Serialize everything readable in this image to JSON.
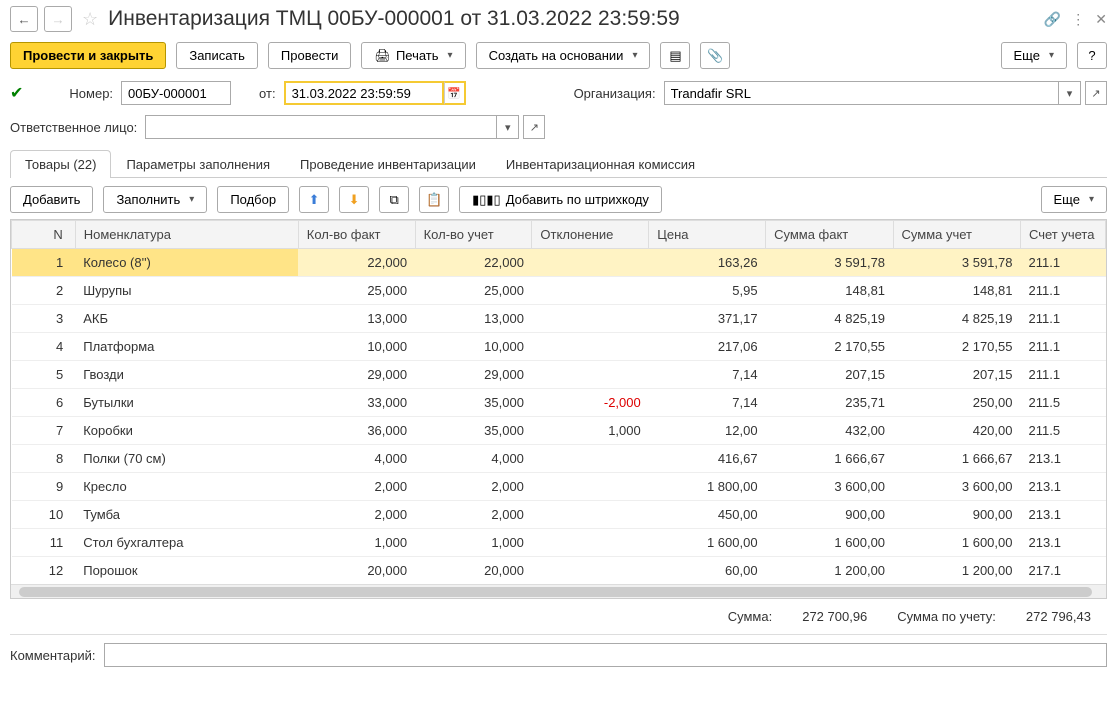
{
  "header": {
    "title": "Инвентаризация ТМЦ 00БУ-000001 от 31.03.2022 23:59:59"
  },
  "toolbar": {
    "post_close": "Провести и закрыть",
    "write": "Записать",
    "post": "Провести",
    "print": "Печать",
    "create_based": "Создать на основании",
    "more": "Еще",
    "help": "?"
  },
  "form": {
    "number_label": "Номер:",
    "number_value": "00БУ-000001",
    "from_label": "от:",
    "date_value": "31.03.2022 23:59:59",
    "org_label": "Организация:",
    "org_value": "Trandafir SRL",
    "resp_label": "Ответственное лицо:",
    "resp_value": ""
  },
  "tabs": {
    "goods": "Товары (22)",
    "fill_params": "Параметры заполнения",
    "inventory": "Проведение инвентаризации",
    "commission": "Инвентаризационная комиссия"
  },
  "table_toolbar": {
    "add": "Добавить",
    "fill": "Заполнить",
    "pick": "Подбор",
    "add_barcode": "Добавить по штрихкоду",
    "more": "Еще"
  },
  "columns": {
    "n": "N",
    "nomen": "Номенклатура",
    "qty_fact": "Кол-во факт",
    "qty_acc": "Кол-во учет",
    "deviation": "Отклонение",
    "price": "Цена",
    "sum_fact": "Сумма факт",
    "sum_acc": "Сумма учет",
    "account": "Счет учета"
  },
  "rows": [
    {
      "n": "1",
      "nomen": "Колесо (8'')",
      "qf": "22,000",
      "qa": "22,000",
      "dev": "",
      "price": "163,26",
      "sf": "3 591,78",
      "sa": "3 591,78",
      "acct": "211.1"
    },
    {
      "n": "2",
      "nomen": "Шурупы",
      "qf": "25,000",
      "qa": "25,000",
      "dev": "",
      "price": "5,95",
      "sf": "148,81",
      "sa": "148,81",
      "acct": "211.1"
    },
    {
      "n": "3",
      "nomen": "АКБ",
      "qf": "13,000",
      "qa": "13,000",
      "dev": "",
      "price": "371,17",
      "sf": "4 825,19",
      "sa": "4 825,19",
      "acct": "211.1"
    },
    {
      "n": "4",
      "nomen": "Платформа",
      "qf": "10,000",
      "qa": "10,000",
      "dev": "",
      "price": "217,06",
      "sf": "2 170,55",
      "sa": "2 170,55",
      "acct": "211.1"
    },
    {
      "n": "5",
      "nomen": "Гвозди",
      "qf": "29,000",
      "qa": "29,000",
      "dev": "",
      "price": "7,14",
      "sf": "207,15",
      "sa": "207,15",
      "acct": "211.1"
    },
    {
      "n": "6",
      "nomen": "Бутылки",
      "qf": "33,000",
      "qa": "35,000",
      "dev": "-2,000",
      "price": "7,14",
      "sf": "235,71",
      "sa": "250,00",
      "acct": "211.5"
    },
    {
      "n": "7",
      "nomen": "Коробки",
      "qf": "36,000",
      "qa": "35,000",
      "dev": "1,000",
      "price": "12,00",
      "sf": "432,00",
      "sa": "420,00",
      "acct": "211.5"
    },
    {
      "n": "8",
      "nomen": "Полки (70 см)",
      "qf": "4,000",
      "qa": "4,000",
      "dev": "",
      "price": "416,67",
      "sf": "1 666,67",
      "sa": "1 666,67",
      "acct": "213.1"
    },
    {
      "n": "9",
      "nomen": "Кресло",
      "qf": "2,000",
      "qa": "2,000",
      "dev": "",
      "price": "1 800,00",
      "sf": "3 600,00",
      "sa": "3 600,00",
      "acct": "213.1"
    },
    {
      "n": "10",
      "nomen": "Тумба",
      "qf": "2,000",
      "qa": "2,000",
      "dev": "",
      "price": "450,00",
      "sf": "900,00",
      "sa": "900,00",
      "acct": "213.1"
    },
    {
      "n": "11",
      "nomen": "Стол бухгалтера",
      "qf": "1,000",
      "qa": "1,000",
      "dev": "",
      "price": "1 600,00",
      "sf": "1 600,00",
      "sa": "1 600,00",
      "acct": "213.1"
    },
    {
      "n": "12",
      "nomen": "Порошок",
      "qf": "20,000",
      "qa": "20,000",
      "dev": "",
      "price": "60,00",
      "sf": "1 200,00",
      "sa": "1 200,00",
      "acct": "217.1"
    }
  ],
  "totals": {
    "sum_label": "Сумма:",
    "sum_value": "272 700,96",
    "sum_acc_label": "Сумма по учету:",
    "sum_acc_value": "272 796,43"
  },
  "comment": {
    "label": "Комментарий:",
    "value": ""
  }
}
